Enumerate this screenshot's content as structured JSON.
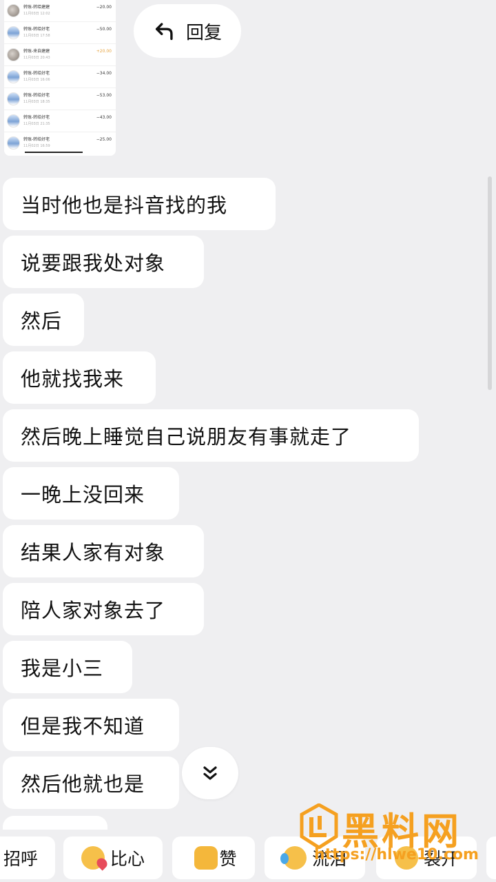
{
  "thumbnail": {
    "rows": [
      {
        "name": "转账-转给建建",
        "time": "11月03日 12:02",
        "amount": "−20.00",
        "alt": true
      },
      {
        "name": "转账-转给好老",
        "time": "11月03日 17:58",
        "amount": "−50.00",
        "alt": false
      },
      {
        "name": "转账-来自建建",
        "time": "11月03日 20:43",
        "amount": "+20.00",
        "alt": true,
        "positive": true
      },
      {
        "name": "转账-转给好老",
        "time": "11月03日 16:06",
        "amount": "−34.00",
        "alt": false
      },
      {
        "name": "转账-转给好老",
        "time": "11月03日 18:35",
        "amount": "−53.00",
        "alt": false
      },
      {
        "name": "转账-转给好老",
        "time": "11月03日 21:35",
        "amount": "−43.00",
        "alt": false
      },
      {
        "name": "转账-转给好老",
        "time": "11月02日 16:59",
        "amount": "−25.00",
        "alt": false
      }
    ]
  },
  "reply_label": "回复",
  "messages": [
    "当时他也是抖音找的我",
    "说要跟我处对象",
    "然后",
    "他就找我来",
    "然后晚上睡觉自己说朋友有事就走了",
    "一晚上没回来",
    "结果人家有对象",
    "陪人家对象去了",
    "我是小三",
    "但是我不知道",
    "然后他就也是"
  ],
  "quick_reactions": [
    {
      "label": "招呼",
      "icon": "wave-icon"
    },
    {
      "label": "比心",
      "icon": "heart-hand-emoji-icon"
    },
    {
      "label": "赞",
      "icon": "thumbs-up-emoji-icon"
    },
    {
      "label": "流泪",
      "icon": "crying-emoji-icon"
    },
    {
      "label": "裂开",
      "icon": "cracked-face-emoji-icon"
    }
  ],
  "watermark": {
    "title": "黑料网",
    "url": "https://hlwe10.com"
  },
  "colors": {
    "background": "#efeff1",
    "bubble": "#ffffff",
    "watermark": "#f5a020"
  }
}
